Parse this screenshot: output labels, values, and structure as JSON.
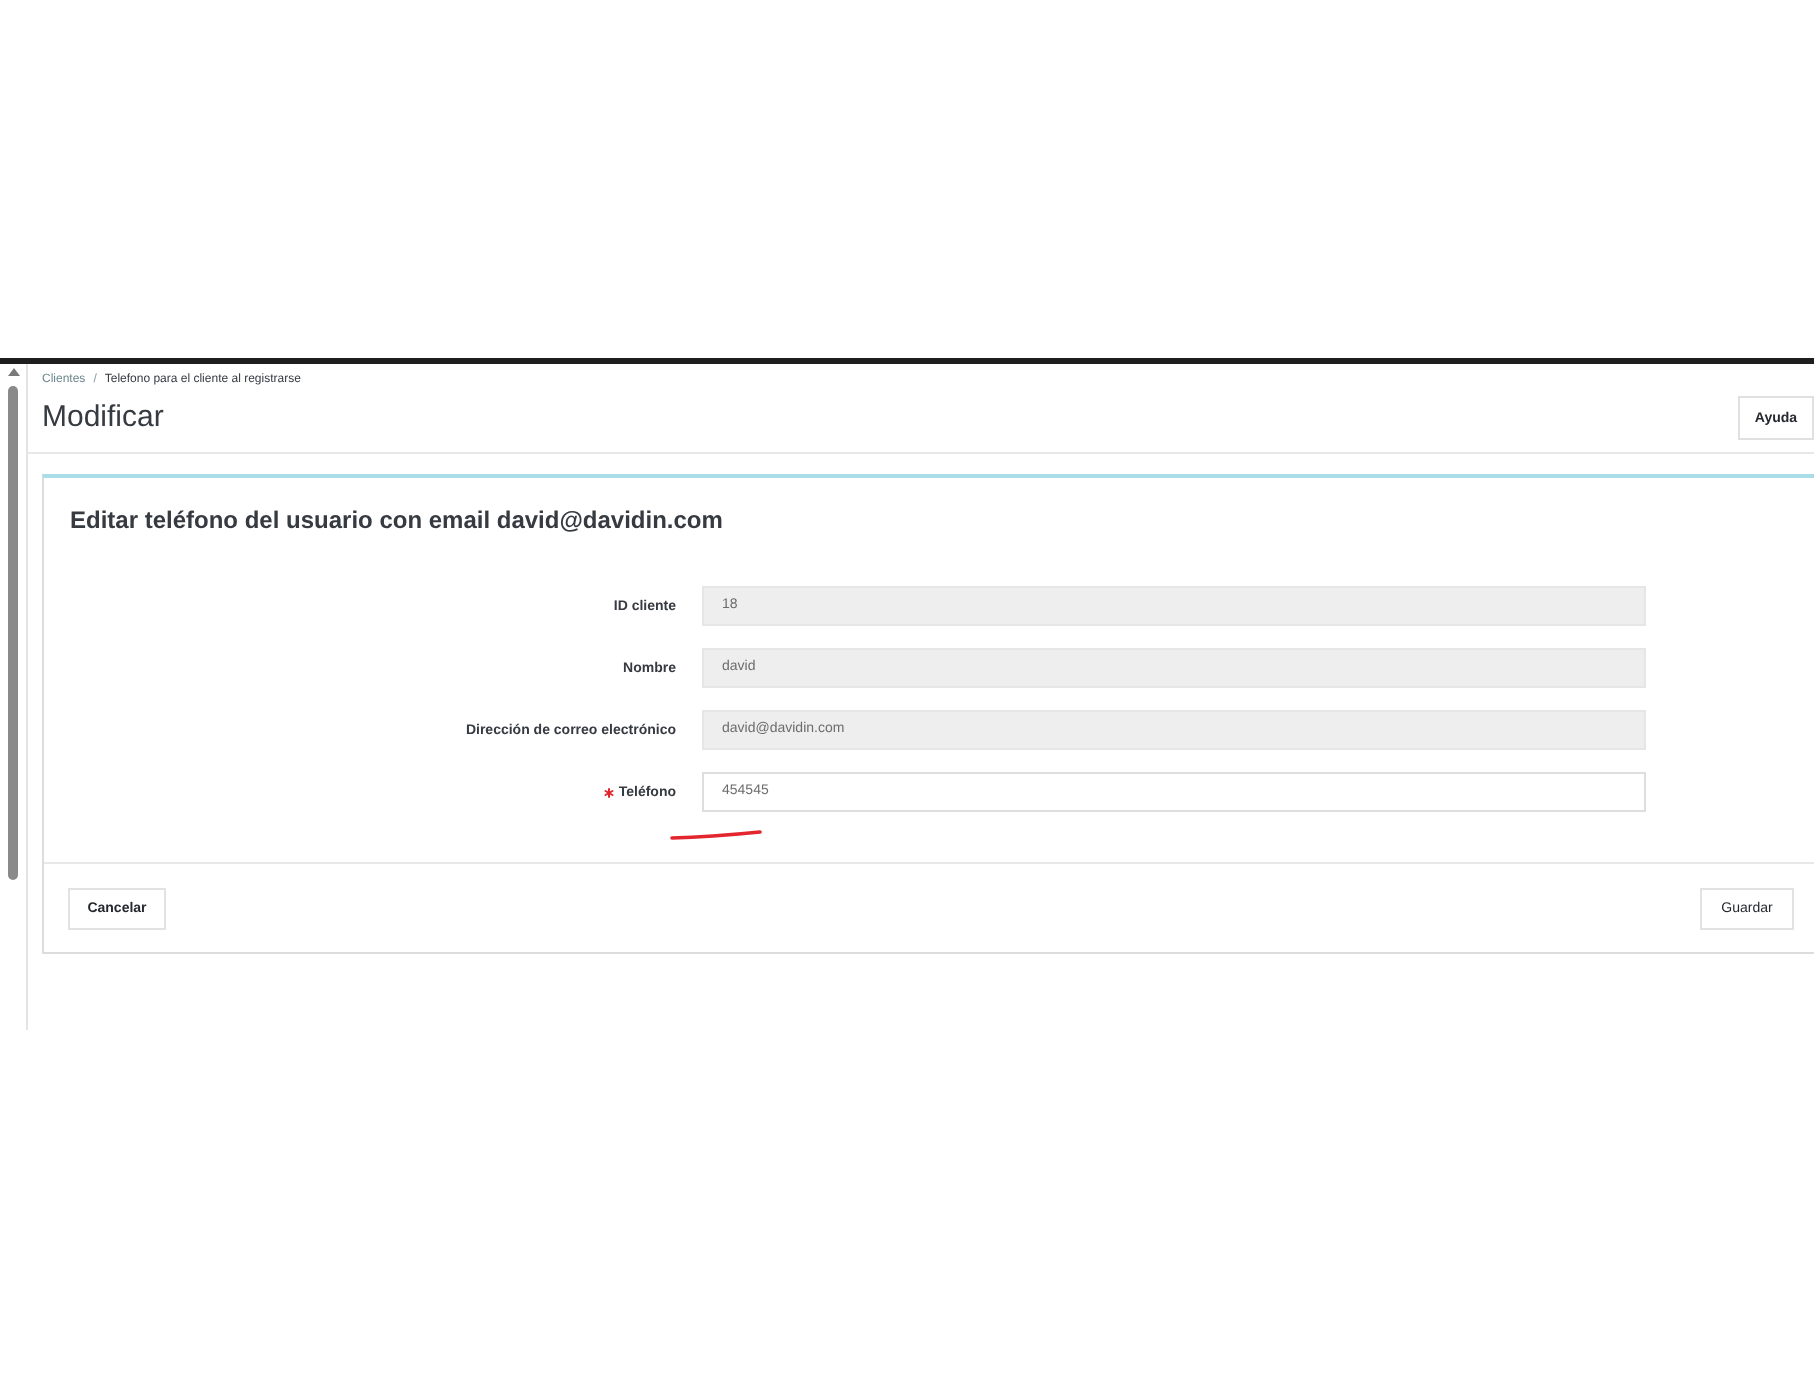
{
  "breadcrumb": {
    "separator": "/",
    "items": [
      {
        "label": "Clientes",
        "kind": "link"
      },
      {
        "label": "Telefono para el cliente al registrarse",
        "kind": "current"
      }
    ]
  },
  "page_title": "Modificar",
  "help_button": "Ayuda",
  "card": {
    "title": "Editar teléfono del usuario con email david@davidin.com",
    "fields": [
      {
        "label": "ID cliente",
        "value": "18",
        "required": false,
        "disabled": true
      },
      {
        "label": "Nombre",
        "value": "david",
        "required": false,
        "disabled": true
      },
      {
        "label": "Dirección de correo electrónico",
        "value": "david@davidin.com",
        "required": false,
        "disabled": true
      },
      {
        "label": "Teléfono",
        "value": "454545",
        "required": true,
        "disabled": false
      }
    ],
    "buttons": [
      {
        "label": "Cancelar",
        "kind": "cancel"
      },
      {
        "label": "Guardar",
        "kind": "save"
      }
    ]
  }
}
